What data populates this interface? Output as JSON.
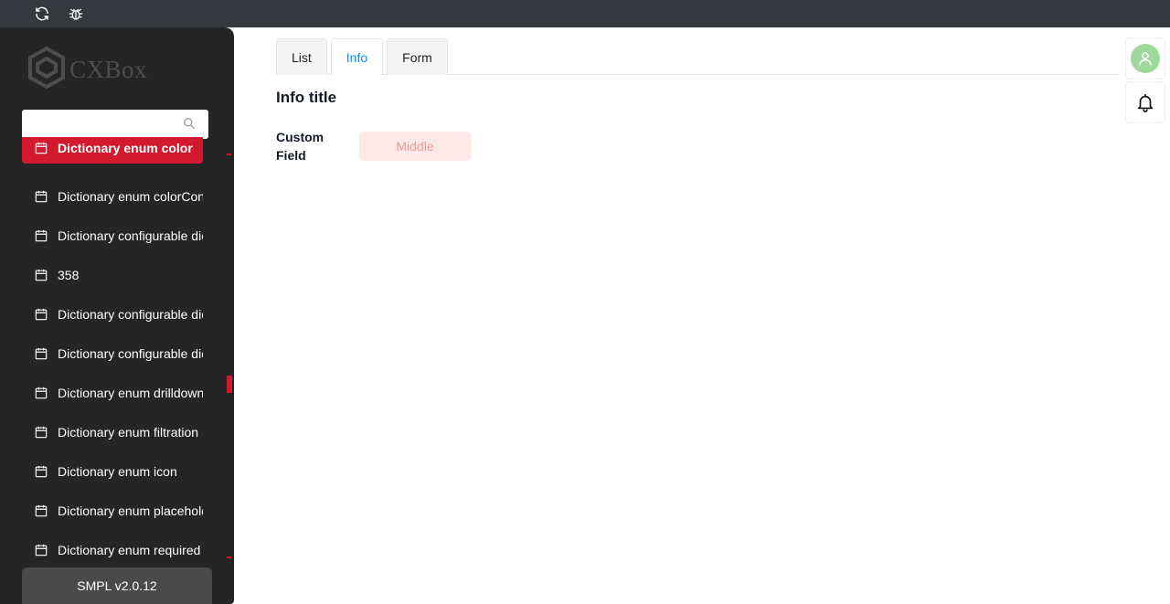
{
  "topbar": {
    "icons": [
      "refresh-icon",
      "bug-icon"
    ]
  },
  "sidebar": {
    "logo_text": "CXBox",
    "search": {
      "value": "",
      "placeholder": ""
    },
    "items": [
      {
        "label": "Dictionary enum color",
        "icon": "calendar-icon",
        "active": true
      },
      {
        "label": "Dictionary enum colorConstant",
        "icon": "calendar-icon"
      },
      {
        "label": "Dictionary configurable dictionary",
        "icon": "calendar-icon"
      },
      {
        "label": "358",
        "icon": "calendar-icon"
      },
      {
        "label": "Dictionary configurable dictionary",
        "icon": "calendar-icon"
      },
      {
        "label": "Dictionary configurable dictionary",
        "icon": "calendar-icon"
      },
      {
        "label": "Dictionary enum drilldown",
        "icon": "calendar-icon"
      },
      {
        "label": "Dictionary enum filtration",
        "icon": "calendar-icon"
      },
      {
        "label": "Dictionary enum icon",
        "icon": "calendar-icon"
      },
      {
        "label": "Dictionary enum placeholder",
        "icon": "calendar-icon"
      },
      {
        "label": "Dictionary enum required",
        "icon": "calendar-icon"
      }
    ],
    "version": "SMPL v2.0.12"
  },
  "main": {
    "tabs": [
      {
        "label": "List",
        "selected": false
      },
      {
        "label": "Info",
        "selected": true
      },
      {
        "label": "Form",
        "selected": false
      }
    ],
    "info_title": "Info title",
    "field": {
      "label": "Custom Field",
      "value": "Middle"
    }
  },
  "colors": {
    "accent": "#d3192f",
    "tab_selected": "#1a8fd6",
    "field_bg": "#fde8e8",
    "field_text": "#ee9a96",
    "avatar_bg": "#9fd89a"
  }
}
